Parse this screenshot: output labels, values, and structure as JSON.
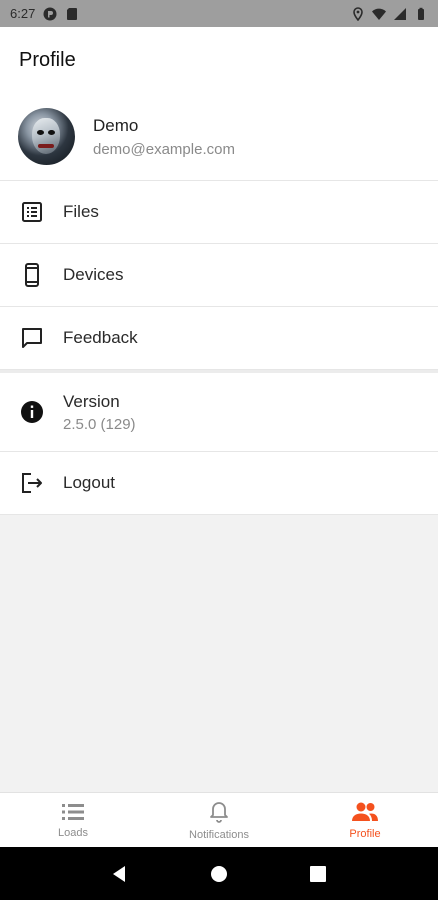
{
  "status_bar": {
    "time": "6:27",
    "icons": [
      "app-p-icon",
      "sd-card-icon",
      "location-icon",
      "wifi-icon",
      "signal-icon",
      "battery-icon"
    ]
  },
  "app_bar": {
    "title": "Profile"
  },
  "profile": {
    "name": "Demo",
    "email": "demo@example.com"
  },
  "menu": [
    {
      "label": "Files",
      "icon": "list-document-icon"
    },
    {
      "label": "Devices",
      "icon": "phone-icon"
    },
    {
      "label": "Feedback",
      "icon": "chat-bubble-icon"
    }
  ],
  "version": {
    "label": "Version",
    "value": "2.5.0 (129)",
    "icon": "info-icon"
  },
  "logout": {
    "label": "Logout",
    "icon": "logout-icon"
  },
  "bottom_nav": {
    "items": [
      {
        "label": "Loads",
        "icon": "list-icon"
      },
      {
        "label": "Notifications",
        "icon": "bell-icon"
      },
      {
        "label": "Profile",
        "icon": "people-icon"
      }
    ],
    "active_color": "#f4511e",
    "inactive_color": "#8d8d8d"
  },
  "system_nav": [
    "back-icon",
    "home-icon",
    "recents-icon"
  ]
}
